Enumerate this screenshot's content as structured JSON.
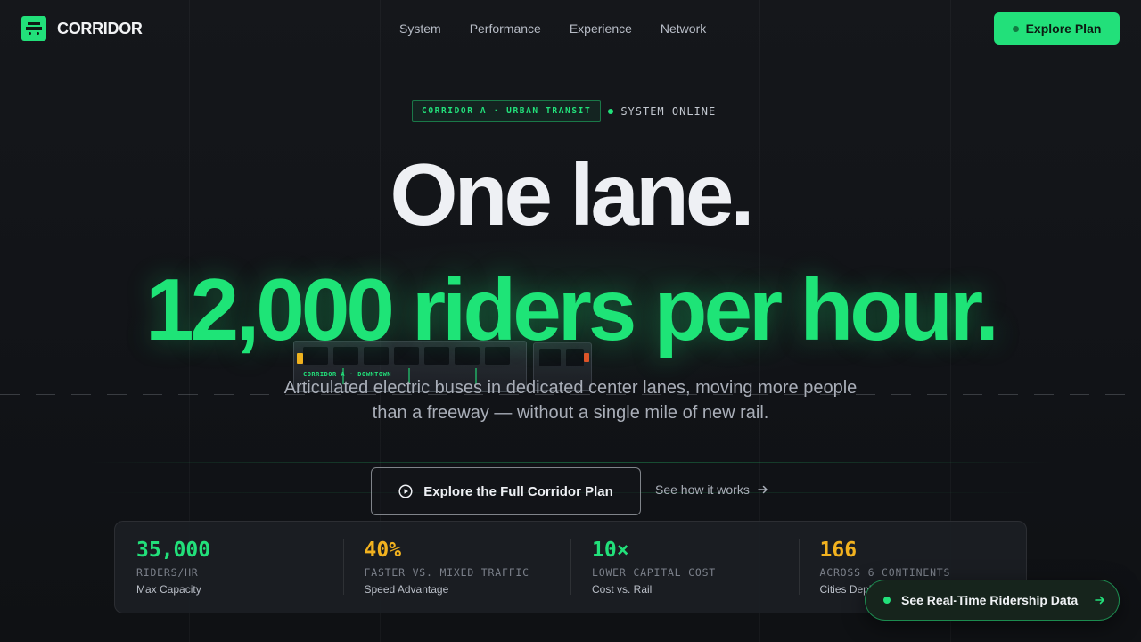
{
  "brand": {
    "name": "CORRIDOR",
    "icon": "bus-logo-icon",
    "accent": "#22e07a"
  },
  "nav": {
    "items": [
      "System",
      "Performance",
      "Experience",
      "Network"
    ],
    "cta_label": "Explore Plan"
  },
  "hero": {
    "badge": "CORRIDOR A · URBAN TRANSIT",
    "status": "SYSTEM ONLINE",
    "headline_1": "One lane.",
    "headline_2": "12,000 riders per hour.",
    "subtitle": "Articulated electric buses in dedicated center lanes, moving more people than a freeway — without a single mile of new rail.",
    "primary_cta": "Explore the Full Corridor Plan",
    "secondary_link": "See how it works",
    "bus_sign": "CORRIDOR A · DOWNTOWN"
  },
  "stats": [
    {
      "value": "35,000",
      "label": "RIDERS/HR",
      "desc": "Max Capacity",
      "color": "#22e07a"
    },
    {
      "value": "40%",
      "label": "FASTER VS. MIXED TRAFFIC",
      "desc": "Speed Advantage",
      "color": "#f2b21f"
    },
    {
      "value": "10×",
      "label": "LOWER CAPITAL COST",
      "desc": "Cost vs. Rail",
      "color": "#22e07a"
    },
    {
      "value": "166",
      "label": "ACROSS 6 CONTINENTS",
      "desc": "Cities Deployed",
      "color": "#f2b21f"
    }
  ],
  "floating_cta": {
    "label": "See Real-Time Ridership Data"
  }
}
